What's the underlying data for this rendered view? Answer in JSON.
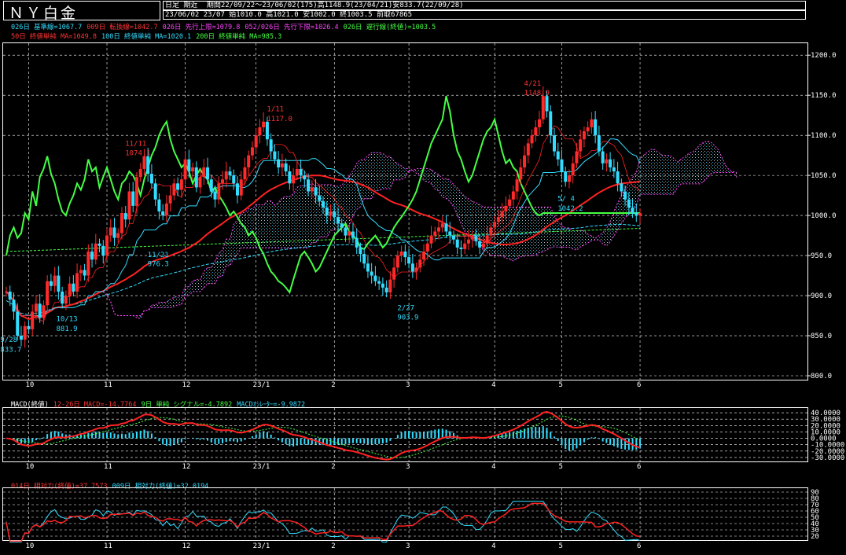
{
  "header": {
    "title": "ＮＹ白金",
    "line1_left": "日足 期近",
    "line1": "期間22/09/22～23/06/02(175)高1148.9(23/04/21)安833.7(22/09/28)",
    "line2": "23/06/02 23/07 始1010.0 高1021.0 安1002.0 終1003.5 前取67865"
  },
  "legend_row1": [
    {
      "text": "026日 基準線=1067.7",
      "color": "#33ddff"
    },
    {
      "text": "009日 転換線=1042.7",
      "color": "#ff3333"
    },
    {
      "text": "026日 先行上限=1079.8",
      "color": "#ff44ff"
    },
    {
      "text": "052/026日 先行下限=1026.4",
      "color": "#ff44ff"
    },
    {
      "text": "026日 遅行線(終値)=1003.5",
      "color": "#44ff44"
    }
  ],
  "legend_row2": [
    {
      "text": "50日 終値単純 MA=1049.8",
      "color": "#ff3333"
    },
    {
      "text": "100日 終値単純 MA=1020.1",
      "color": "#33ddff"
    },
    {
      "text": "200日 終値単純 MA=985.3",
      "color": "#44ff44"
    }
  ],
  "macd_legend": [
    {
      "text": "MACD(終値)",
      "color": "#ffffff"
    },
    {
      "text": "12-26日 MACD=-14.7764",
      "color": "#ff3333"
    },
    {
      "text": "9日 単純 シグナル=-4.7892",
      "color": "#44ff44"
    },
    {
      "text": "MACDｵｼﾚｰﾀｰ=-9.9872",
      "color": "#33ddff"
    }
  ],
  "rsi_legend": [
    {
      "text": "014日 相対力(終値)=37.7573",
      "color": "#ff3333"
    },
    {
      "text": "009日 相対力(終値)=32.0194",
      "color": "#33ddff"
    }
  ],
  "annotations": [
    {
      "text": "9/28",
      "color": "#33ddff",
      "x": 0.5,
      "y": 842
    },
    {
      "text": "833.7",
      "color": "#33ddff",
      "x": 0.5,
      "y": 830
    },
    {
      "text": "10/13",
      "color": "#33ddff",
      "x": 15.5,
      "y": 868
    },
    {
      "text": "881.9",
      "color": "#33ddff",
      "x": 15.5,
      "y": 856
    },
    {
      "text": "11/11",
      "color": "#ff3333",
      "x": 34,
      "y": 1087
    },
    {
      "text": "1074.1",
      "color": "#ff3333",
      "x": 34,
      "y": 1075
    },
    {
      "text": "11/21",
      "color": "#33ddff",
      "x": 40,
      "y": 948
    },
    {
      "text": "976.3",
      "color": "#33ddff",
      "x": 40,
      "y": 937
    },
    {
      "text": "1/11",
      "color": "#ff3333",
      "x": 72,
      "y": 1130
    },
    {
      "text": "1117.0",
      "color": "#ff3333",
      "x": 72,
      "y": 1118
    },
    {
      "text": "2/27",
      "color": "#33ddff",
      "x": 107,
      "y": 882
    },
    {
      "text": "903.9",
      "color": "#33ddff",
      "x": 107,
      "y": 870
    },
    {
      "text": "4/21",
      "color": "#ff3333",
      "x": 141,
      "y": 1162
    },
    {
      "text": "1148.9",
      "color": "#ff3333",
      "x": 141,
      "y": 1150
    },
    {
      "text": "5/ 4",
      "color": "#33ddff",
      "x": 150,
      "y": 1018
    },
    {
      "text": "1042.2",
      "color": "#33ddff",
      "x": 150,
      "y": 1006
    }
  ],
  "chart_data": [
    {
      "type": "candlestick",
      "name": "price",
      "x_labels": [
        {
          "text": "10",
          "i": 6
        },
        {
          "text": "11",
          "i": 27
        },
        {
          "text": "12",
          "i": 48
        },
        {
          "text": "23/1",
          "i": 67
        },
        {
          "text": "2",
          "i": 88
        },
        {
          "text": "3",
          "i": 108
        },
        {
          "text": "4",
          "i": 131
        },
        {
          "text": "5",
          "i": 149
        },
        {
          "text": "6",
          "i": 170
        }
      ],
      "ylim": [
        800,
        1210
      ],
      "yticks": [
        800,
        850,
        900,
        950,
        1000,
        1050,
        1100,
        1150,
        1200
      ],
      "ytick_labels": [
        "800.0",
        "850.0",
        "900.0",
        "950.0",
        "1000.0",
        "1050.0",
        "1100.0",
        "1150.0",
        "1200.0"
      ],
      "bars": 175,
      "close": [
        905,
        895,
        880,
        850,
        845,
        862,
        858,
        880,
        890,
        872,
        888,
        918,
        912,
        925,
        905,
        890,
        899,
        915,
        905,
        928,
        932,
        925,
        955,
        945,
        965,
        962,
        950,
        975,
        985,
        972,
        978,
        1003,
        995,
        1030,
        1012,
        1048,
        1058,
        1074,
        1052,
        1040,
        1020,
        1005,
        1000,
        1015,
        1025,
        1040,
        1032,
        1045,
        1070,
        1055,
        1060,
        1035,
        1048,
        1060,
        1045,
        1030,
        1020,
        1040,
        1045,
        1055,
        1050,
        1040,
        1025,
        1045,
        1060,
        1075,
        1085,
        1100,
        1110,
        1117,
        1095,
        1080,
        1070,
        1060,
        1065,
        1055,
        1040,
        1050,
        1058,
        1050,
        1045,
        1030,
        1035,
        1025,
        1018,
        1010,
        1000,
        1005,
        998,
        990,
        985,
        975,
        980,
        972,
        960,
        952,
        940,
        930,
        925,
        918,
        915,
        910,
        904,
        920,
        935,
        950,
        955,
        948,
        940,
        930,
        935,
        945,
        955,
        965,
        975,
        980,
        985,
        990,
        980,
        975,
        970,
        960,
        958,
        965,
        970,
        975,
        968,
        960,
        965,
        975,
        985,
        992,
        998,
        1005,
        1012,
        1020,
        1030,
        1045,
        1060,
        1075,
        1090,
        1100,
        1110,
        1120,
        1149,
        1130,
        1100,
        1080,
        1070,
        1055,
        1042,
        1050,
        1065,
        1080,
        1095,
        1105,
        1110,
        1120,
        1100,
        1080,
        1065,
        1070,
        1060,
        1055,
        1040,
        1030,
        1020,
        1010,
        1003,
        1000,
        1003
      ]
    },
    {
      "type": "line",
      "name": "macd",
      "ylim": [
        -35,
        45
      ],
      "ytick_labels": [
        "40.0000",
        "30.0000",
        "20.0000",
        "10.0000",
        "0.0000",
        "-10.0000",
        "-20.0000",
        "-30.0000"
      ],
      "yticks": [
        40,
        30,
        20,
        10,
        0,
        -10,
        -20,
        -30
      ]
    },
    {
      "type": "line",
      "name": "rsi",
      "ylim": [
        15,
        95
      ],
      "yticks": [
        90,
        80,
        70,
        60,
        50,
        40,
        30,
        20
      ],
      "ytick_labels": [
        "90",
        "80",
        "70",
        "60",
        "50",
        "40",
        "30",
        "20"
      ]
    }
  ]
}
